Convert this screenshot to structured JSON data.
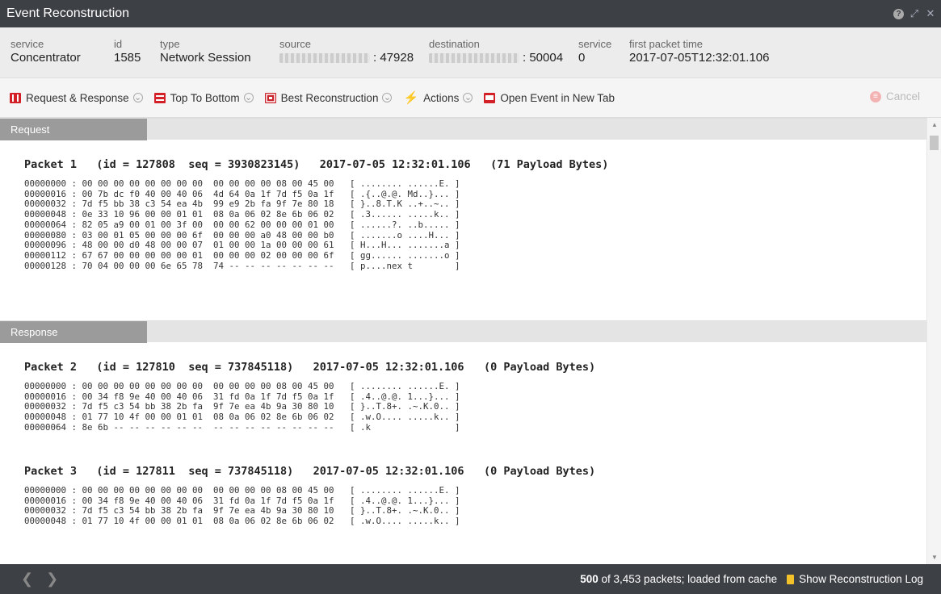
{
  "window": {
    "title": "Event Reconstruction"
  },
  "meta": [
    {
      "label": "service",
      "value": "Concentrator"
    },
    {
      "label": "id",
      "value": "1585"
    },
    {
      "label": "type",
      "value": "Network Session"
    },
    {
      "label": "source",
      "value": ": 47928"
    },
    {
      "label": "destination",
      "value": ": 50004"
    },
    {
      "label": "service",
      "value": "0"
    },
    {
      "label": "first packet time",
      "value": "2017-07-05T12:32:01.106"
    }
  ],
  "toolbar": {
    "request_response": "Request & Response",
    "top_to_bottom": "Top To Bottom",
    "best_reconstruction": "Best Reconstruction",
    "actions": "Actions",
    "open_event": "Open Event in New Tab",
    "cancel": "Cancel",
    "colors": {
      "red": "#d32027",
      "accent": "#c9252c"
    }
  },
  "sections": {
    "request": {
      "label": "Request",
      "packets": [
        {
          "header": "Packet 1   (id = 127808  seq = 3930823145)   2017-07-05 12:32:01.106   (71 Payload Bytes)",
          "lines": [
            "00000000 : 00 00 00 00 00 00 00 00  00 00 00 00 08 00 45 00   [ ........ ......E. ]",
            "00000016 : 00 7b dc f0 40 00 40 06  4d 64 0a 1f 7d f5 0a 1f   [ .{..@.@. Md..}... ]",
            "00000032 : 7d f5 bb 38 c3 54 ea 4b  99 e9 2b fa 9f 7e 80 18   [ }..8.T.K ..+..~.. ]",
            "00000048 : 0e 33 10 96 00 00 01 01  08 0a 06 02 8e 6b 06 02   [ .3...... .....k.. ]",
            "00000064 : 82 05 a9 00 01 00 3f 00  00 00 62 00 00 00 01 00   [ ......?. ..b..... ]",
            "00000080 : 03 00 01 05 00 00 00 6f  00 00 00 a0 48 00 00 b0   [ .......o ....H... ]",
            "00000096 : 48 00 00 d0 48 00 00 07  01 00 00 1a 00 00 00 61   [ H...H... .......a ]",
            "00000112 : 67 67 00 00 00 00 00 01  00 00 00 02 00 00 00 6f   [ gg...... .......o ]",
            "00000128 : 70 04 00 00 00 6e 65 78  74 -- -- -- -- -- -- --   [ p....nex t        ]"
          ]
        }
      ]
    },
    "response": {
      "label": "Response",
      "packets": [
        {
          "header": "Packet 2   (id = 127810  seq = 737845118)   2017-07-05 12:32:01.106   (0 Payload Bytes)",
          "lines": [
            "00000000 : 00 00 00 00 00 00 00 00  00 00 00 00 08 00 45 00   [ ........ ......E. ]",
            "00000016 : 00 34 f8 9e 40 00 40 06  31 fd 0a 1f 7d f5 0a 1f   [ .4..@.@. 1...}... ]",
            "00000032 : 7d f5 c3 54 bb 38 2b fa  9f 7e ea 4b 9a 30 80 10   [ }..T.8+. .~.K.0.. ]",
            "00000048 : 01 77 10 4f 00 00 01 01  08 0a 06 02 8e 6b 06 02   [ .w.O.... .....k.. ]",
            "00000064 : 8e 6b -- -- -- -- -- --  -- -- -- -- -- -- -- --   [ .k                ]"
          ]
        },
        {
          "header": "Packet 3   (id = 127811  seq = 737845118)   2017-07-05 12:32:01.106   (0 Payload Bytes)",
          "lines": [
            "00000000 : 00 00 00 00 00 00 00 00  00 00 00 00 08 00 45 00   [ ........ ......E. ]",
            "00000016 : 00 34 f8 9e 40 00 40 06  31 fd 0a 1f 7d f5 0a 1f   [ .4..@.@. 1...}... ]",
            "00000032 : 7d f5 c3 54 bb 38 2b fa  9f 7e ea 4b 9a 30 80 10   [ }..T.8+. .~.K.0.. ]",
            "00000048 : 01 77 10 4f 00 00 01 01  08 0a 06 02 8e 6b 06 02   [ .w.O.... .....k.. ]"
          ]
        }
      ]
    }
  },
  "status": {
    "count": "500",
    "summary": "of 3,453 packets; loaded from cache",
    "log_label": "Show Reconstruction Log"
  }
}
